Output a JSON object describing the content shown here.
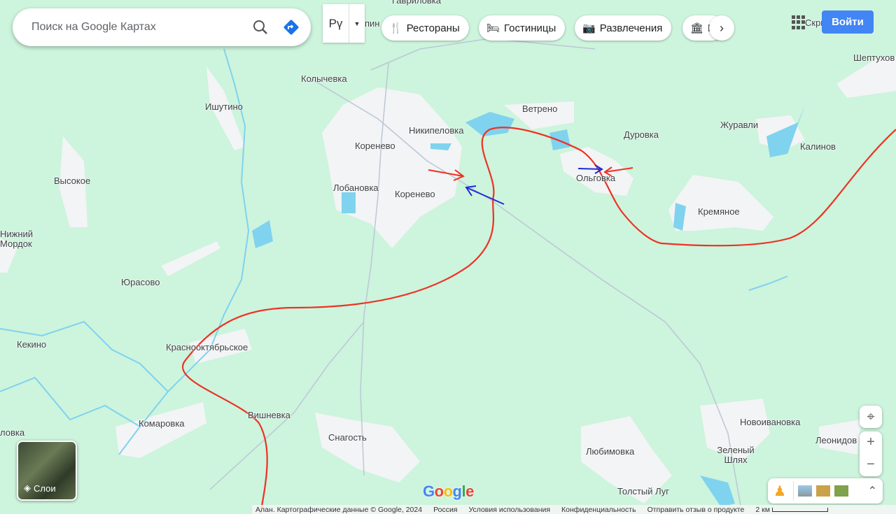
{
  "search": {
    "placeholder": "Поиск на Google Картах"
  },
  "language": {
    "value": "Рү"
  },
  "chips": [
    {
      "icon": "restaurant-icon",
      "label": "Рестораны"
    },
    {
      "icon": "hotel-icon",
      "label": "Гостиницы"
    },
    {
      "icon": "camera-icon",
      "label": "Развлечения"
    },
    {
      "icon": "museum-icon",
      "label": "М"
    }
  ],
  "header": {
    "signin": "Войти"
  },
  "layers": {
    "label": "Слои"
  },
  "places": [
    "Гавриловка",
    "Колычевка",
    "Ишутино",
    "Никипеловка",
    "Ветрено",
    "Дуровка",
    "Журавли",
    "Калинов",
    "Шептухов",
    "Коренево",
    "Коренево",
    "Лобановка",
    "Ольговка",
    "Кремяное",
    "Высокое",
    "Нижний Мордок",
    "Юрасово",
    "Кекино",
    "Краснооктябрьское",
    "Комаровка",
    "Вишневка",
    "Снагость",
    "Любимовка",
    "Новоивановка",
    "Леонидов",
    "Зеленый Шлях",
    "Толстый Луг",
    "ловка",
    "Скры",
    "пин"
  ],
  "footer": {
    "data": "Алан. Картографические данные © Google, 2024",
    "country": "Россия",
    "terms": "Условия использования",
    "privacy": "Конфиденциальность",
    "feedback": "Отправить отзыв о продукте",
    "scale": "2 км"
  },
  "logo": "Google",
  "colors": {
    "land": "#cdf4dd",
    "urban": "#f1f3f4",
    "water": "#7fd3ee",
    "frontline": "#ee3124",
    "arrow_red": "#ee3124",
    "arrow_blue": "#1f2bd6",
    "accent": "#4285f4"
  }
}
